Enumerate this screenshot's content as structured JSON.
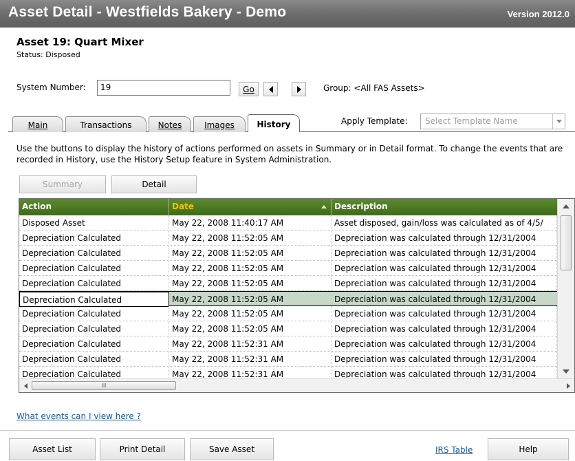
{
  "window": {
    "title": "Asset Detail - Westfields Bakery - Demo",
    "version": "Version 2012.0"
  },
  "asset": {
    "name": "Asset 19: Quart Mixer",
    "status": "Status: Disposed"
  },
  "system_number": {
    "label": "System Number:",
    "value": "19",
    "go_label": "Go"
  },
  "group": {
    "label": "Group: <All FAS Assets>"
  },
  "tabs": [
    {
      "label": "Main",
      "active": false
    },
    {
      "label": "Transactions",
      "active": false
    },
    {
      "label": "Notes",
      "active": false
    },
    {
      "label": "Images",
      "active": false
    },
    {
      "label": "History",
      "active": true
    }
  ],
  "template": {
    "label": "Apply Template:",
    "placeholder": "Select Template Name"
  },
  "instructions": "Use the buttons to display the history of actions performed on assets in Summary or in Detail format.  To change the events that are recorded in History, use the History Setup feature in System Administration.",
  "view_buttons": {
    "summary": "Summary",
    "detail": "Detail"
  },
  "grid": {
    "columns": [
      "Action",
      "Date",
      "Description"
    ],
    "sorted_column": "Date",
    "header_color": "#4a7a22",
    "rows": [
      {
        "action": "Disposed Asset",
        "date": "May 22, 2008   11:40:17 AM",
        "description": "Asset disposed, gain/loss was calculated as of 4/5/"
      },
      {
        "action": "Depreciation Calculated",
        "date": "May 22, 2008   11:52:05 AM",
        "description": "Depreciation was calculated through 12/31/2004"
      },
      {
        "action": "Depreciation Calculated",
        "date": "May 22, 2008   11:52:05 AM",
        "description": "Depreciation was calculated through 12/31/2004"
      },
      {
        "action": "Depreciation Calculated",
        "date": "May 22, 2008   11:52:05 AM",
        "description": "Depreciation was calculated through 12/31/2004"
      },
      {
        "action": "Depreciation Calculated",
        "date": "May 22, 2008   11:52:05 AM",
        "description": "Depreciation was calculated through 12/31/2004"
      },
      {
        "action": "Depreciation Calculated",
        "date": "May 22, 2008   11:52:05 AM",
        "description": "Depreciation was calculated through 12/31/2004",
        "selected": true
      },
      {
        "action": "Depreciation Calculated",
        "date": "May 22, 2008   11:52:05 AM",
        "description": "Depreciation was calculated through 12/31/2004"
      },
      {
        "action": "Depreciation Calculated",
        "date": "May 22, 2008   11:52:05 AM",
        "description": "Depreciation was calculated through 12/31/2004"
      },
      {
        "action": "Depreciation Calculated",
        "date": "May 22, 2008   11:52:31 AM",
        "description": "Depreciation was calculated through 12/31/2004"
      },
      {
        "action": "Depreciation Calculated",
        "date": "May 22, 2008   11:52:31 AM",
        "description": "Depreciation was calculated through 12/31/2004"
      },
      {
        "action": "Depreciation Calculated",
        "date": "May 22, 2008   11:52:31 AM",
        "description": "Depreciation was calculated through 12/31/2004"
      }
    ],
    "hscroll_thumb_label": "III"
  },
  "help_link": "What events can I view here ?",
  "footer": {
    "asset_list": "Asset List",
    "print_detail": "Print Detail",
    "save_asset": "Save Asset",
    "irs_table": "IRS Table",
    "help": "Help"
  }
}
